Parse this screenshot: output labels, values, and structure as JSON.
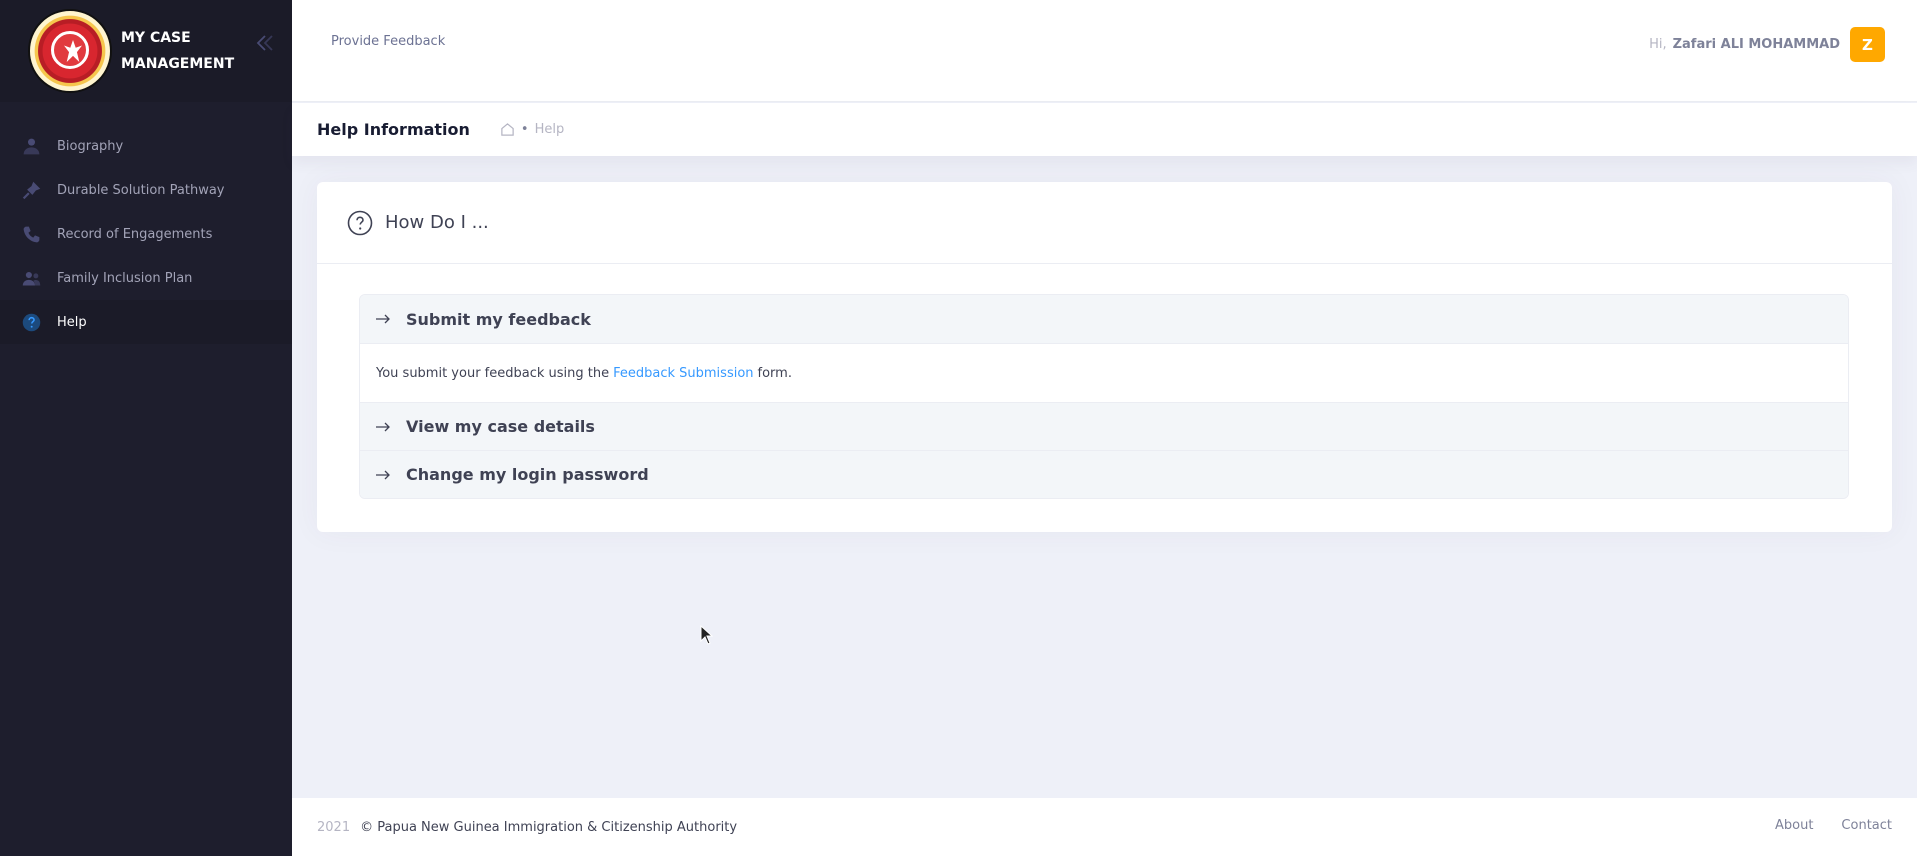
{
  "app": {
    "title": "MY CASE MANAGEMENT",
    "title_line1": "MY CASE",
    "title_line2": "MANAGEMENT"
  },
  "sidebar": {
    "items": [
      {
        "label": "Biography",
        "icon": "user-icon",
        "active": false
      },
      {
        "label": "Durable Solution Pathway",
        "icon": "pin-icon",
        "active": false
      },
      {
        "label": "Record of Engagements",
        "icon": "phone-icon",
        "active": false
      },
      {
        "label": "Family Inclusion Plan",
        "icon": "group-icon",
        "active": false
      },
      {
        "label": "Help",
        "icon": "question-icon",
        "active": true
      }
    ]
  },
  "header": {
    "provide_feedback": "Provide Feedback",
    "greeting": "Hi,",
    "username": "Zafari ALI MOHAMMAD",
    "avatar_letter": "Z",
    "avatar_color": "#ffa800"
  },
  "subheader": {
    "title": "Help Information",
    "breadcrumb_current": "Help"
  },
  "card": {
    "title": "How Do I ...",
    "items": [
      {
        "title": "Submit my feedback",
        "expanded": true,
        "body_prefix": "You submit your feedback using the",
        "body_link": "Feedback Submission",
        "body_suffix": "form."
      },
      {
        "title": "View my case details",
        "expanded": false
      },
      {
        "title": "Change my login password",
        "expanded": false
      }
    ]
  },
  "footer": {
    "year": "2021",
    "copyright": "© Papua New Guinea Immigration & Citizenship Authority",
    "links": [
      "About",
      "Contact"
    ]
  },
  "colors": {
    "sidebar_bg": "#1e1e2d",
    "link": "#3699ff",
    "page_bg": "#eef0f8"
  }
}
